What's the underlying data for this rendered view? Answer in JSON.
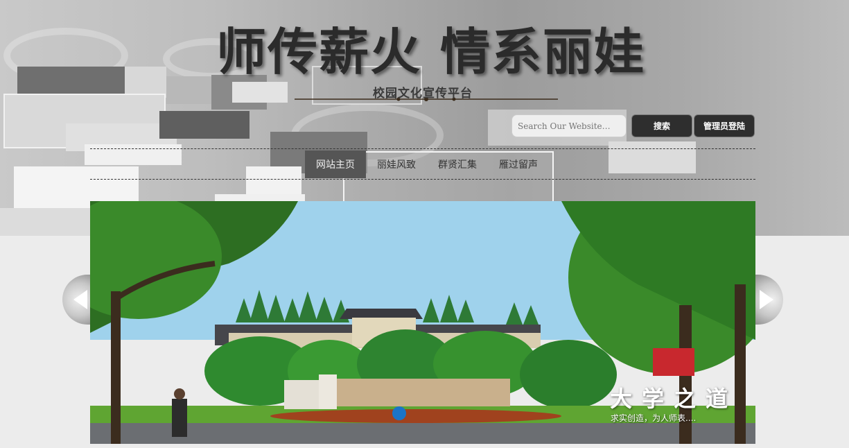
{
  "header": {
    "title": "师传薪火 情系丽娃",
    "subtitle": "校园文化宣传平台"
  },
  "search": {
    "placeholder": "Search Our Website…",
    "button_label": "搜索"
  },
  "admin": {
    "button_label": "管理员登陆"
  },
  "nav": {
    "items": [
      {
        "label": "网站主页",
        "active": true
      },
      {
        "label": "丽娃风致",
        "active": false
      },
      {
        "label": "群贤汇集",
        "active": false
      },
      {
        "label": "雁过留声",
        "active": false
      }
    ]
  },
  "slider": {
    "caption_title": "大学之道",
    "caption_text": "求实创造，为人师表....",
    "prev_icon": "chevron-left-icon",
    "next_icon": "chevron-right-icon"
  },
  "colors": {
    "nav_active_bg": "#555555",
    "button_bg": "#2e2e2e",
    "page_bg": "#ececec"
  }
}
